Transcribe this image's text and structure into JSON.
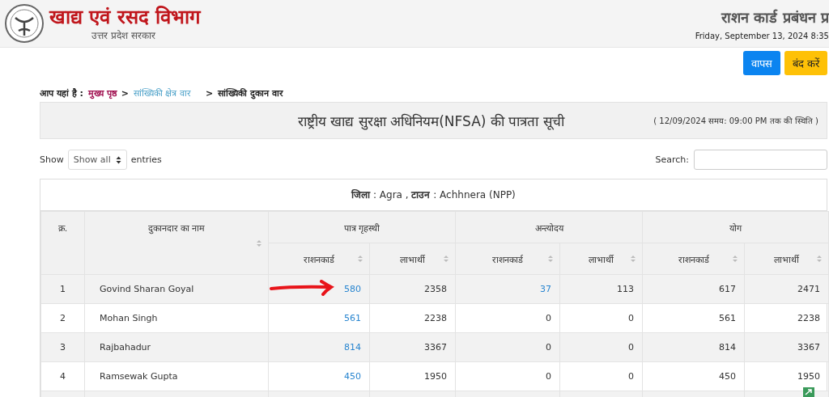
{
  "header": {
    "title": "खाद्य एवं रसद विभाग",
    "subtitle": "उत्तर प्रदेश सरकार",
    "right_title": "राशन कार्ड प्रबंधन प्र",
    "date": "Friday, September 13, 2024 8:35"
  },
  "buttons": [
    {
      "label": "वापस",
      "kind": "primary"
    },
    {
      "label": "बंद करें",
      "kind": "warning"
    }
  ],
  "breadcrumb": {
    "prefix": "आप यहां है :",
    "items": [
      {
        "label": "मुख्य पृष्ठ",
        "kind": "home"
      },
      {
        "separator": ">",
        "label": "सांख्यिकी क्षेत्र वार",
        "kind": "link"
      },
      {
        "separator": ">",
        "label": "सांख्यिकी दुकान वार",
        "kind": "current"
      }
    ]
  },
  "panel": {
    "title": "राष्ट्रीय खाद्य सुरक्षा अधिनियम(NFSA) की पात्रता सूची",
    "status": "( 12/09/2024 समय: 09:00 PM तक की स्थिति )"
  },
  "length": {
    "before": "Show",
    "value": "Show all",
    "after": "entries"
  },
  "search": {
    "label": "Search:"
  },
  "table": {
    "caption": [
      {
        "label": "जिला",
        "value": ": Agra ,"
      },
      {
        "label": "टाउन",
        "value": ": Achhnera (NPP)"
      }
    ],
    "header_rows": [
      [
        {
          "label": "क्र.",
          "rowspan": 2,
          "sortable": false
        },
        {
          "label": "दुकानदार का नाम",
          "rowspan": 2,
          "sortable": true
        },
        {
          "label": "पात्र गृहस्थी",
          "colspan": 2,
          "sortable": false
        },
        {
          "label": "अन्त्योदय",
          "colspan": 2,
          "sortable": false
        },
        {
          "label": "योग",
          "colspan": 2,
          "sortable": false
        }
      ],
      [
        {
          "label": "राशनकार्ड",
          "sortable": true
        },
        {
          "label": "लाभार्थी",
          "sortable": true
        },
        {
          "label": "राशनकार्ड",
          "sortable": true
        },
        {
          "label": "लाभार्थी",
          "sortable": true
        },
        {
          "label": "राशनकार्ड",
          "sortable": true
        },
        {
          "label": "लाभार्थी",
          "sortable": true
        }
      ]
    ],
    "rows": [
      {
        "no": "1",
        "name": "Govind Sharan Goyal",
        "cells": [
          {
            "text": "580",
            "link": true
          },
          {
            "text": "2358",
            "link": false
          },
          {
            "text": "37",
            "link": true
          },
          {
            "text": "113",
            "link": false
          },
          {
            "text": "617",
            "link": false
          },
          {
            "text": "2471",
            "link": false
          }
        ]
      },
      {
        "no": "2",
        "name": "Mohan Singh",
        "cells": [
          {
            "text": "561",
            "link": true
          },
          {
            "text": "2238",
            "link": false
          },
          {
            "text": "0",
            "link": false
          },
          {
            "text": "0",
            "link": false
          },
          {
            "text": "561",
            "link": false
          },
          {
            "text": "2238",
            "link": false
          }
        ]
      },
      {
        "no": "3",
        "name": "Rajbahadur",
        "cells": [
          {
            "text": "814",
            "link": true
          },
          {
            "text": "3367",
            "link": false
          },
          {
            "text": "0",
            "link": false
          },
          {
            "text": "0",
            "link": false
          },
          {
            "text": "814",
            "link": false
          },
          {
            "text": "3367",
            "link": false
          }
        ]
      },
      {
        "no": "4",
        "name": "Ramsewak Gupta",
        "cells": [
          {
            "text": "450",
            "link": true
          },
          {
            "text": "1950",
            "link": false
          },
          {
            "text": "0",
            "link": false
          },
          {
            "text": "0",
            "link": false
          },
          {
            "text": "450",
            "link": false
          },
          {
            "text": "1950",
            "link": false
          }
        ]
      }
    ]
  }
}
